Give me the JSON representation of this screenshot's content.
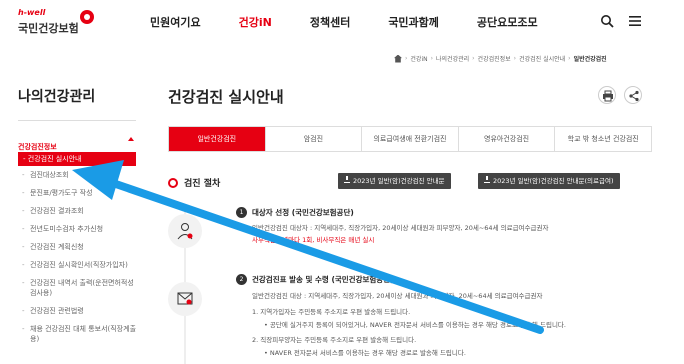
{
  "header": {
    "logo_small": "h-well",
    "logo_main": "국민건강보험",
    "nav": [
      "민원여기요",
      "건강iN",
      "정책센터",
      "국민과함께",
      "공단요모조모"
    ],
    "active_nav_index": 1
  },
  "breadcrumb": [
    "건강iN",
    "나의건강관리",
    "건강검진정보",
    "건강검진 실시안내",
    "일반건강검진"
  ],
  "sidebar": {
    "title": "나의건강관리",
    "section": "건강검진정보",
    "active_item": "- 건강검진 실시안내",
    "items": [
      "검진대상조회",
      "문진표/평가도구 작성",
      "건강검진 결과조회",
      "전년도미수검자 추가신청",
      "건강검진 계획신청",
      "건강검진 실시확인서(직장가입자)",
      "건강검진 내역서 출력(운전면허적성검사용)",
      "건강검진 관련법령",
      "채용 건강검진 대체 통보서(직장계출용)"
    ]
  },
  "main": {
    "title": "건강검진 실시안내",
    "tabs": [
      "일반건강검진",
      "암검진",
      "의료급여생애 전환기검진",
      "영유아건강검진",
      "학교 밖 청소년 건강검진"
    ],
    "active_tab_index": 0,
    "section_label": "검진 절차",
    "download_buttons": [
      "2023년 일반(암)건강검진 안내문",
      "2023년 일반(암)건강검진 안내문(의료급여)"
    ],
    "steps": [
      {
        "num": "1",
        "title": "대상자 선정 (국민건강보험공단)",
        "lines": [
          "일반건강검진 대상자 : 지역세대주, 직장가입자, 20세이상 세대원과 피부양자, 20세~64세 의료급여수급권자",
          "사무직은 2년마다 1회, 비사무직은 매년 실시"
        ]
      },
      {
        "num": "2",
        "title": "건강검진표 발송 및 수령 (국민건강보험공단)",
        "lines": [
          "일반건강검진 대상 : 지역세대주, 직장가입자, 20세이상 세대원과 피부양자, 20세~64세 의료급여수급권자",
          "1. 지역가입자는 주민등록 주소지로 우편 발송해 드립니다.",
          "• 공단에 실거주지 등록이 되어있거나, NAVER 전자문서 서비스를 이용하는 경우 해당 경로로 발송해 드립니다.",
          "2. 직장피부양자는 주민등록 주소지로 우편 발송해 드립니다.",
          "• NAVER 전자문서 서비스를 이용하는 경우 해당 경로로 발송해 드립니다."
        ]
      }
    ]
  },
  "colors": {
    "accent": "#e60012",
    "arrow": "#1a9be6",
    "dark_button": "#444444"
  },
  "icons": [
    "search-icon",
    "menu-icon",
    "home-icon",
    "print-icon",
    "share-icon",
    "doctor-icon",
    "mail-icon"
  ]
}
